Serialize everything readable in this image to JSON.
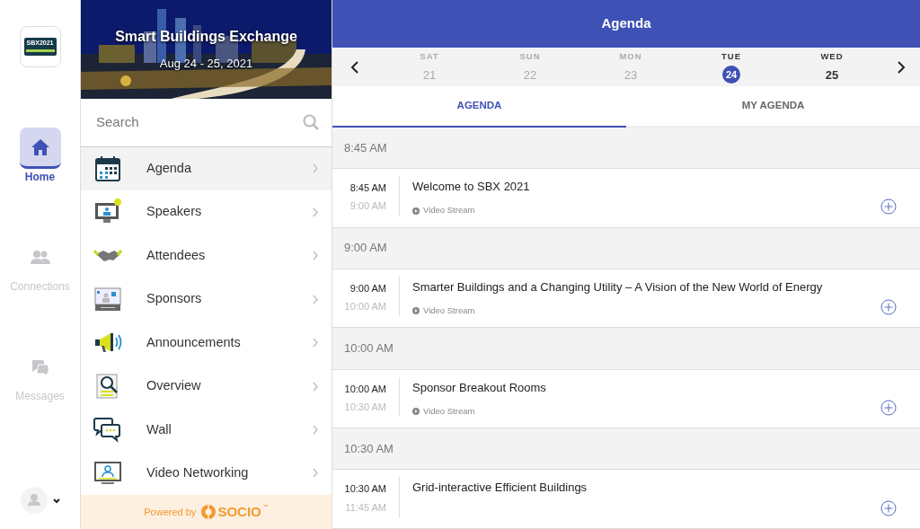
{
  "rail": {
    "items": [
      {
        "label": "Home",
        "selected": true
      },
      {
        "label": "Connections",
        "selected": false
      },
      {
        "label": "Messages",
        "selected": false
      }
    ]
  },
  "event": {
    "title": "Smart Buildings Exchange",
    "dates": "Aug 24 - 25, 2021",
    "logo_title": "SBX2021"
  },
  "search": {
    "placeholder": "Search"
  },
  "menu": [
    {
      "label": "Agenda",
      "selected": true
    },
    {
      "label": "Speakers",
      "selected": false
    },
    {
      "label": "Attendees",
      "selected": false
    },
    {
      "label": "Sponsors",
      "selected": false
    },
    {
      "label": "Announcements",
      "selected": false
    },
    {
      "label": "Overview",
      "selected": false
    },
    {
      "label": "Wall",
      "selected": false
    },
    {
      "label": "Video Networking",
      "selected": false
    }
  ],
  "footer": {
    "text": "Powered by",
    "brand": "SOCIO",
    "mark": "™"
  },
  "header": {
    "title": "Agenda"
  },
  "days": [
    {
      "weekday": "SAT",
      "day": "21",
      "selected": false,
      "disabled": true
    },
    {
      "weekday": "SUN",
      "day": "22",
      "selected": false,
      "disabled": true
    },
    {
      "weekday": "MON",
      "day": "23",
      "selected": false,
      "disabled": true
    },
    {
      "weekday": "TUE",
      "day": "24",
      "selected": true,
      "disabled": false
    },
    {
      "weekday": "WED",
      "day": "25",
      "selected": false,
      "disabled": false
    }
  ],
  "tabs": [
    {
      "label": "AGENDA",
      "selected": true
    },
    {
      "label": "MY AGENDA",
      "selected": false
    }
  ],
  "groups": [
    {
      "time": "8:45 AM",
      "sessions": [
        {
          "start": "8:45 AM",
          "end": "9:00 AM",
          "title": "Welcome to SBX 2021",
          "stream": "Video Stream"
        }
      ]
    },
    {
      "time": "9:00 AM",
      "sessions": [
        {
          "start": "9:00 AM",
          "end": "10:00 AM",
          "title": "Smarter Buildings and a Changing Utility – A Vision of the New World of Energy",
          "stream": "Video Stream"
        }
      ]
    },
    {
      "time": "10:00 AM",
      "sessions": [
        {
          "start": "10:00 AM",
          "end": "10:30 AM",
          "title": "Sponsor Breakout Rooms",
          "stream": "Video Stream"
        }
      ]
    },
    {
      "time": "10:30 AM",
      "sessions": [
        {
          "start": "10:30 AM",
          "end": "11:45 AM",
          "title": "Grid-interactive Efficient Buildings"
        }
      ]
    }
  ]
}
